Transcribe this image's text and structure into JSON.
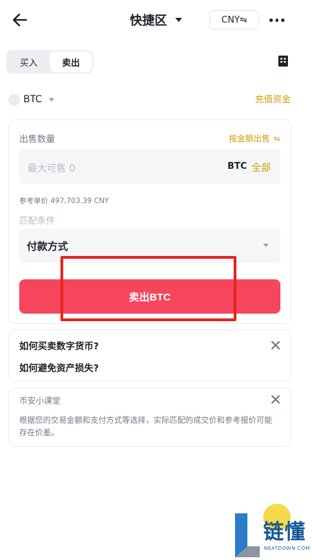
{
  "header": {
    "title": "快捷区",
    "currency": "CNY⇋"
  },
  "tabs": [
    {
      "label": "买入",
      "active": false
    },
    {
      "label": "卖出",
      "active": true
    }
  ],
  "coin_row": {
    "coin": "BTC",
    "fund_link": "充值资金"
  },
  "sell_form": {
    "qty_label": "出售数量",
    "by_amount_label": "按金额出售",
    "by_amount_icon": "⇋",
    "amount_placeholder": "最大可售 0",
    "unit": "BTC",
    "all_label": "全部",
    "reference_price": "参考单价 497,703.39 CNY",
    "match_label": "匹配条件",
    "payment_method": "付款方式",
    "sell_button": "卖出BTC"
  },
  "faq": {
    "q1": "如何买卖数字货币?",
    "q2": "如何避免资产损失?"
  },
  "lesson": {
    "title": "币安小课堂",
    "body": "根据您的交易金额和支付方式等选择，实际匹配的成交价和参考报价可能存在价差。"
  },
  "watermark": {
    "name": "链懂",
    "url": "NEATDOWN.COM"
  },
  "colors": {
    "accent_gold": "#d29e0c",
    "sell_red": "#f6465d",
    "highlight_red": "#e6241f"
  }
}
